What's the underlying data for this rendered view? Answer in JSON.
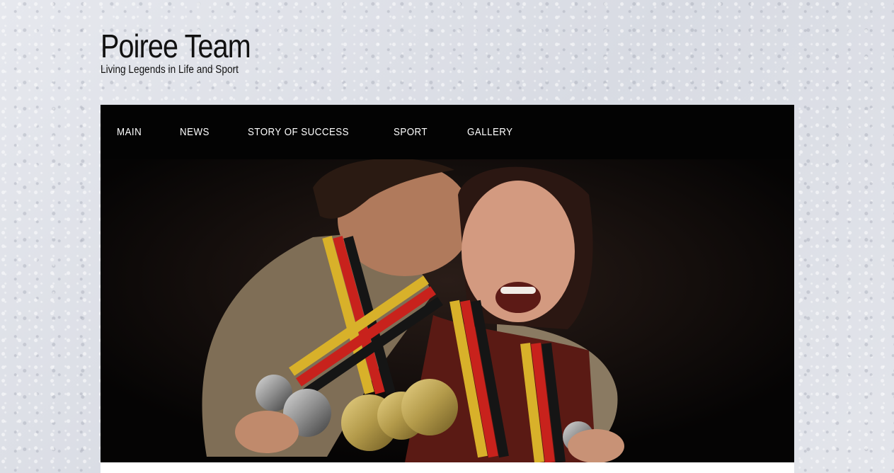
{
  "site": {
    "title": "Poiree Team",
    "tagline": "Living Legends in Life and Sport"
  },
  "nav": {
    "items": [
      {
        "label": "MAIN"
      },
      {
        "label": "NEWS"
      },
      {
        "label": "STORY OF SUCCESS"
      },
      {
        "label": "SPORT"
      },
      {
        "label": "GALLERY"
      }
    ]
  },
  "hero": {
    "image": "photo-of-two-athletes-with-medals"
  },
  "colors": {
    "nav_background": "#030303",
    "nav_text": "#ffffff",
    "page_background": "#dfe1e8",
    "title_text": "#111111"
  }
}
